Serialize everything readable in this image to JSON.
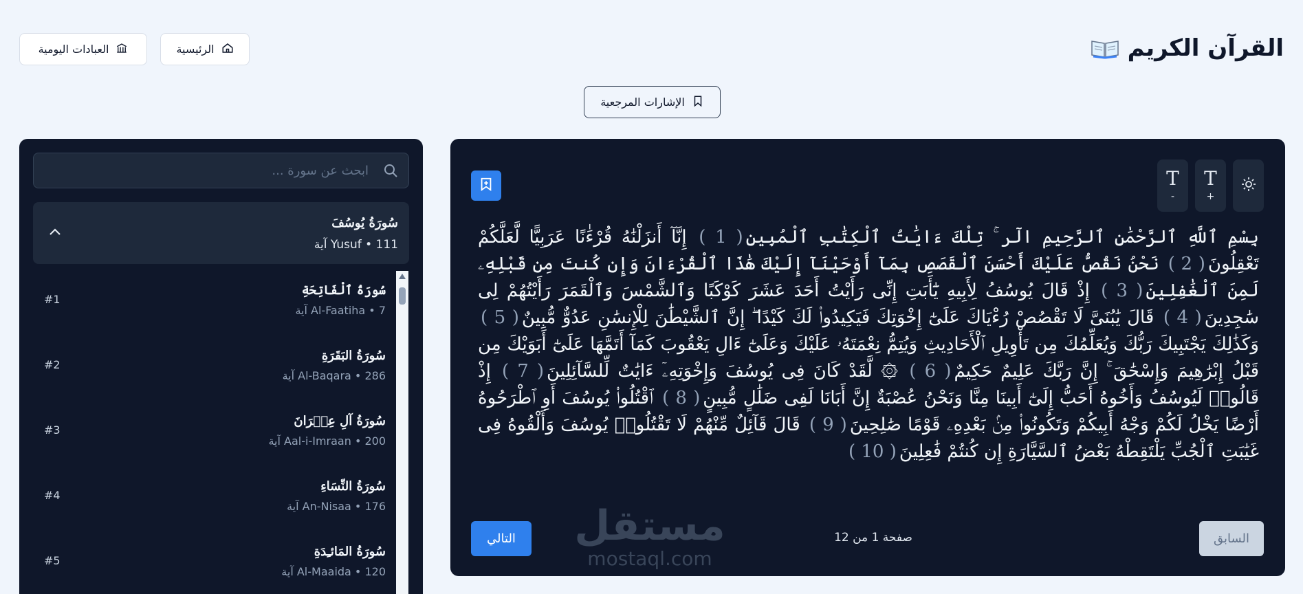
{
  "header": {
    "title": "القرآن الكريم",
    "icon": "open-book-icon"
  },
  "nav": {
    "home_label": "الرئيسية",
    "home_icon": "home-icon",
    "daily_label": "العبادات اليومية",
    "daily_icon": "mosque-icon"
  },
  "bookmarks_button": {
    "label": "الإشارات المرجعية",
    "icon": "bookmark-icon"
  },
  "reader": {
    "font_increase": {
      "glyph": "T",
      "sign": "+"
    },
    "font_decrease": {
      "glyph": "T",
      "sign": "-"
    },
    "theme_icon": "sun-icon",
    "add_bookmark_icon": "bookmark-plus-icon",
    "basmala": "بِسْمِ ٱللَّهِ ٱلرَّحْمَٰنِ ٱلرَّحِيمِ",
    "verses": [
      {
        "text": "الٓر ۚ تِلْكَ ءَايَٰتُ ٱلْكِتَٰبِ ٱلْمُبِينِ",
        "number": "( 1 )"
      },
      {
        "text": "إِنَّآ أَنزَلْنَٰهُ قُرْءَٰنًا عَرَبِيًّا لَّعَلَّكُمْ تَعْقِلُونَ",
        "number": "( 2 )"
      },
      {
        "text": "نَحْنُ نَقُصُّ عَلَيْكَ أَحْسَنَ ٱلْقَصَصِ بِمَآ أَوْحَيْنَآ إِلَيْكَ هَٰذَا ٱلْقُرْءَانَ وَإِن كُنتَ مِن قَبْلِهِۦ لَمِنَ ٱلْغَٰفِلِينَ",
        "number": "( 3 )"
      },
      {
        "text": "إِذْ قَالَ يُوسُفُ لِأَبِيهِ يَٰٓأَبَتِ إِنِّى رَأَيْتُ أَحَدَ عَشَرَ كَوْكَبًا وَٱلشَّمْسَ وَٱلْقَمَرَ رَأَيْتُهُمْ لِى سَٰجِدِينَ",
        "number": "( 4 )"
      },
      {
        "text": "قَالَ يَٰبُنَىَّ لَا تَقْصُصْ رُءْيَاكَ عَلَىٰٓ إِخْوَتِكَ فَيَكِيدُوا۟ لَكَ كَيْدًا ۖ إِنَّ ٱلشَّيْطَٰنَ لِلْإِنسَٰنِ عَدُوٌّ مُّبِينٌ",
        "number": "( 5 )"
      },
      {
        "text": "وَكَذَٰلِكَ يَجْتَبِيكَ رَبُّكَ وَيُعَلِّمُكَ مِن تَأْوِيلِ ٱلْأَحَادِيثِ وَيُتِمُّ نِعْمَتَهُۥ عَلَيْكَ وَعَلَىٰٓ ءَالِ يَعْقُوبَ كَمَآ أَتَمَّهَا عَلَىٰٓ أَبَوَيْكَ مِن قَبْلُ إِبْرَٰهِيمَ وَإِسْحَٰقَ ۚ إِنَّ رَبَّكَ عَلِيمٌ حَكِيمٌ",
        "number": "( 6 )"
      },
      {
        "text": "۞ لَّقَدْ كَانَ فِى يُوسُفَ وَإِخْوَتِهِۦٓ ءَايَٰتٌ لِّلسَّآئِلِينَ",
        "number": "( 7 )"
      },
      {
        "text": "إِذْ قَالُوا۟ لَيُوسُفُ وَأَخُوهُ أَحَبُّ إِلَىٰٓ أَبِينَا مِنَّا وَنَحْنُ عُصْبَةٌ إِنَّ أَبَانَا لَفِى ضَلَٰلٍ مُّبِينٍ",
        "number": "( 8 )"
      },
      {
        "text": "ٱقْتُلُوا۟ يُوسُفَ أَوِ ٱطْرَحُوهُ أَرْضًا يَخْلُ لَكُمْ وَجْهُ أَبِيكُمْ وَتَكُونُوا۟ مِنۢ بَعْدِهِۦ قَوْمًا صَٰلِحِينَ",
        "number": "( 9 )"
      },
      {
        "text": "قَالَ قَآئِلٌ مِّنْهُمْ لَا تَقْتُلُوا۟ يُوسُفَ وَأَلْقُوهُ فِى غَيَٰبَتِ ٱلْجُبِّ يَلْتَقِطْهُ بَعْضُ ٱلسَّيَّارَةِ إِن كُنتُمْ فَٰعِلِينَ",
        "number": "( 10 )"
      }
    ],
    "prev_label": "السابق",
    "next_label": "التالي",
    "page_info": "صفحة 1 من 12",
    "watermark_ar": "مستقل",
    "watermark_en": "mostaql.com"
  },
  "sidebar": {
    "search_placeholder": "ابحث عن سورة ...",
    "search_icon": "search-icon",
    "current": {
      "name": "سُورَةُ يُوسُفَ",
      "meta": "Yusuf • 111 آية",
      "toggle_icon": "chevron-up-icon"
    },
    "surahs": [
      {
        "name": "سُورَةُ ٱلْفَاتِحَةِ",
        "meta": "Al-Faatiha • 7 آية",
        "num": "#1"
      },
      {
        "name": "سُورَةُ البَقَرَةِ",
        "meta": "Al-Baqara • 286 آية",
        "num": "#2"
      },
      {
        "name": "سُورَةُ آلِ عِمۡرَانَ",
        "meta": "Aal-i-Imraan • 200 آية",
        "num": "#3"
      },
      {
        "name": "سُورَةُ النِّسَاءِ",
        "meta": "An-Nisaa • 176 آية",
        "num": "#4"
      },
      {
        "name": "سُورَةُ المَائـِدَةِ",
        "meta": "Al-Maaida • 120 آية",
        "num": "#5"
      }
    ]
  },
  "colors": {
    "accent": "#2f80ed",
    "panel": "#0f172a",
    "panel_item": "#1e293b",
    "page_bg": "#f0f5fc"
  }
}
